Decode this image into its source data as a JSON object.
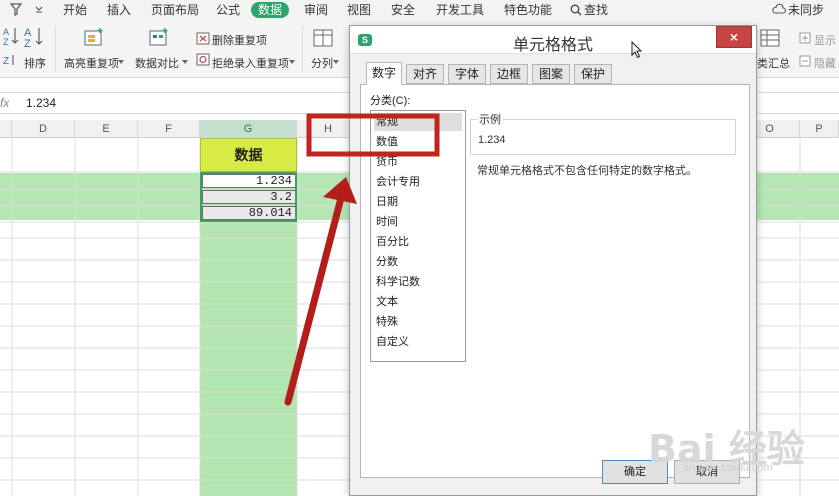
{
  "menubar": {
    "items": [
      "开始",
      "插入",
      "页面布局",
      "公式",
      "数据",
      "审阅",
      "视图",
      "安全",
      "开发工具",
      "特色功能",
      "查找"
    ],
    "sync_label": "未同步"
  },
  "ribbon": {
    "sort_label": "排序",
    "highlight_dup_label": "高亮重复项",
    "compare_label": "数据对比",
    "delete_dup_label": "删除重复项",
    "reject_dup_label": "拒绝录入重复项",
    "split_label": "分列",
    "subtotal_label": "类汇总",
    "show_label": "显示",
    "hide_label": "隐藏"
  },
  "formula_bar": {
    "fx": "fx",
    "value": "1.234"
  },
  "columns": [
    "D",
    "E",
    "F",
    "G",
    "H",
    "O",
    "P"
  ],
  "sheet": {
    "header": "数据",
    "values": [
      "1.234",
      "3.2",
      "89.014"
    ]
  },
  "dialog": {
    "title": "单元格格式",
    "close": "×",
    "logo": "S",
    "tabs": [
      "数字",
      "对齐",
      "字体",
      "边框",
      "图案",
      "保护"
    ],
    "category_label": "分类(C):",
    "categories": [
      "常规",
      "数值",
      "货币",
      "会计专用",
      "日期",
      "时间",
      "百分比",
      "分数",
      "科学记数",
      "文本",
      "特殊",
      "自定义"
    ],
    "sample_label": "示例",
    "sample_value": "1.234",
    "description": "常规单元格格式不包含任何特定的数字格式。",
    "ok": "确定",
    "cancel": "取消"
  },
  "annotation": {
    "highlight_color": "#c0241d",
    "arrow_color": "#b41e1a"
  },
  "watermark": {
    "brand": "Bai 经验",
    "url": "jingyan.baidu.com"
  },
  "colors": {
    "accent_green": "#2ea36c",
    "row_highlight": "#b6e6b4",
    "data_header": "#d8ea44",
    "close_red": "#c74444"
  }
}
